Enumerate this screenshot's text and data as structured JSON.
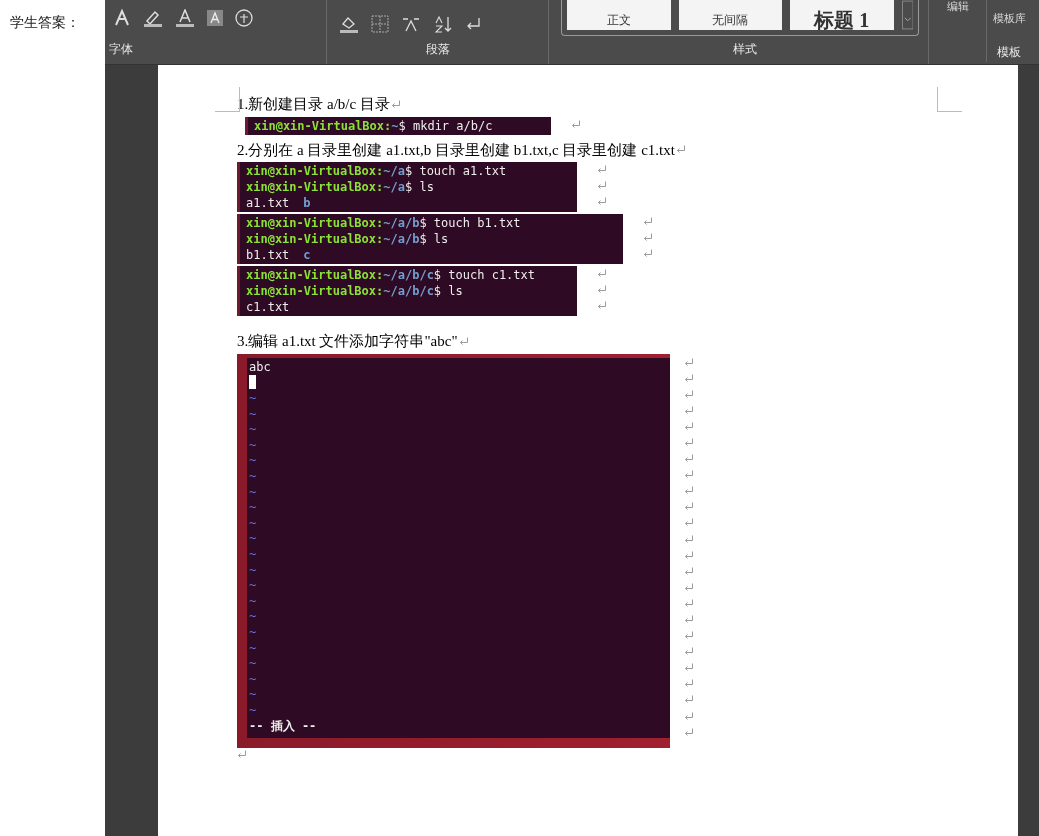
{
  "answer_label": "学生答案：",
  "ribbon": {
    "groups": [
      {
        "kind": "font",
        "label": "字体"
      },
      {
        "kind": "paragraph",
        "label": "段落"
      },
      {
        "kind": "styles",
        "label": "样式",
        "styles": [
          "正文",
          "无间隔",
          "标题 1"
        ]
      },
      {
        "kind": "editing",
        "label": "编辑"
      },
      {
        "kind": "templates",
        "label": "模板",
        "button": "模板库"
      }
    ]
  },
  "document": {
    "sections": [
      {
        "heading": "1.新创建目录 a/b/c 目录",
        "terminals": [
          {
            "kind": "narrow",
            "lines": [
              {
                "kind": "prompt",
                "host": "xin@xin-VirtualBox:",
                "path": "~",
                "command": "$ mkdir a/b/c"
              }
            ]
          }
        ]
      },
      {
        "heading": "2.分别在 a 目录里创建 a1.txt,b 目录里创建 b1.txt,c 目录里创建 c1.txt",
        "terminals": [
          {
            "kind": "medium",
            "lines": [
              {
                "kind": "prompt",
                "host": "xin@xin-VirtualBox:",
                "path": "~/a",
                "command": "$ touch a1.txt"
              },
              {
                "kind": "prompt",
                "host": "xin@xin-VirtualBox:",
                "path": "~/a",
                "command": "$ ls"
              },
              {
                "kind": "output",
                "items": [
                  {
                    "text": "a1.txt",
                    "kind": "file"
                  },
                  {
                    "text": "b",
                    "kind": "dir"
                  }
                ]
              }
            ]
          },
          {
            "kind": "wide",
            "lines": [
              {
                "kind": "prompt",
                "host": "xin@xin-VirtualBox:",
                "path": "~/a/b",
                "command": "$ touch b1.txt"
              },
              {
                "kind": "prompt",
                "host": "xin@xin-VirtualBox:",
                "path": "~/a/b",
                "command": "$ ls"
              },
              {
                "kind": "output",
                "items": [
                  {
                    "text": "b1.txt",
                    "kind": "file"
                  },
                  {
                    "text": "c",
                    "kind": "dir"
                  }
                ]
              }
            ]
          },
          {
            "kind": "medium",
            "lines": [
              {
                "kind": "prompt",
                "host": "xin@xin-VirtualBox:",
                "path": "~/a/b/c",
                "command": "$ touch c1.txt"
              },
              {
                "kind": "prompt",
                "host": "xin@xin-VirtualBox:",
                "path": "~/a/b/c",
                "command": "$ ls"
              },
              {
                "kind": "output",
                "items": [
                  {
                    "text": "c1.txt",
                    "kind": "file"
                  }
                ]
              }
            ]
          }
        ]
      },
      {
        "heading": "3.编辑 a1.txt 文件添加字符串\"abc\"",
        "editor": {
          "text": "abc",
          "empty_lines": [
            "~",
            "~",
            "~",
            "~",
            "~",
            "~",
            "~",
            "~",
            "~",
            "~",
            "~",
            "~",
            "~",
            "~",
            "~",
            "~",
            "~",
            "~",
            "~",
            "~",
            "~"
          ],
          "mode": "-- 插入 --"
        }
      }
    ]
  }
}
